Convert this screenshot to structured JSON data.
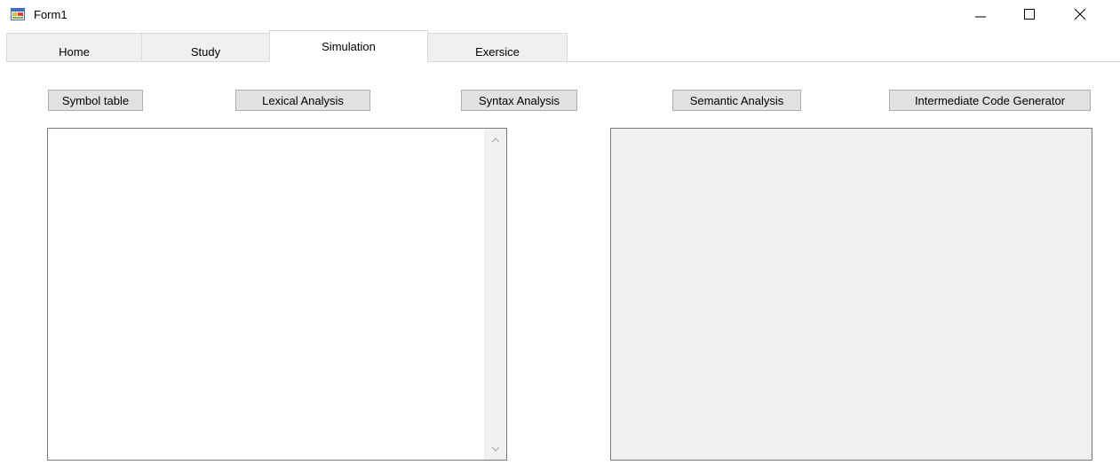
{
  "window": {
    "title": "Form1",
    "icon": "winforms-form-icon"
  },
  "tabs": [
    {
      "label": "Home",
      "active": false
    },
    {
      "label": "Study",
      "active": false
    },
    {
      "label": "Simulation",
      "active": true
    },
    {
      "label": "Exersice",
      "active": false
    }
  ],
  "toolbar": {
    "symbol_table": "Symbol table",
    "lexical_analysis": "Lexical Analysis",
    "syntax_analysis": "Syntax Analysis",
    "semantic_analysis": "Semantic Analysis",
    "intermediate_code_generator": "Intermediate Code Generator"
  },
  "input_area": {
    "value": ""
  },
  "colors": {
    "button_face": "#e1e1e1",
    "control_face": "#f0f0f0",
    "border": "#7a7a7a"
  }
}
